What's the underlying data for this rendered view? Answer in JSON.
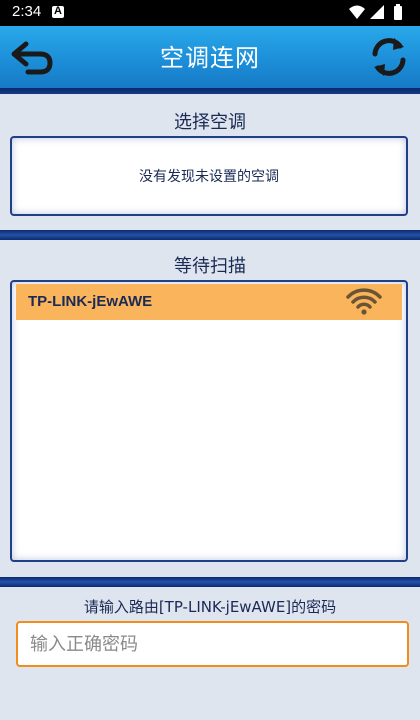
{
  "status_bar": {
    "time": "2:34",
    "notification_badge": "A",
    "icons": [
      "wifi-icon",
      "cell-signal-icon",
      "battery-icon"
    ]
  },
  "header": {
    "title": "空调连网",
    "back_icon": "back-arrow-icon",
    "refresh_icon": "refresh-icon"
  },
  "select_ac": {
    "title": "选择空调",
    "empty_message": "没有发现未设置的空调"
  },
  "scan": {
    "title": "等待扫描",
    "networks": [
      {
        "ssid": "TP-LINK-jEwAWE",
        "icon": "wifi-signal-icon"
      }
    ]
  },
  "password": {
    "label": "请输入路由[TP-LINK-jEwAWE]的密码",
    "placeholder": "输入正确密码",
    "value": ""
  },
  "colors": {
    "header_blue": "#1c8ed8",
    "panel_bg": "#dfe5ef",
    "selected_row": "#f9b45c",
    "input_border": "#f28c1c",
    "text_dark": "#1a2a55"
  }
}
